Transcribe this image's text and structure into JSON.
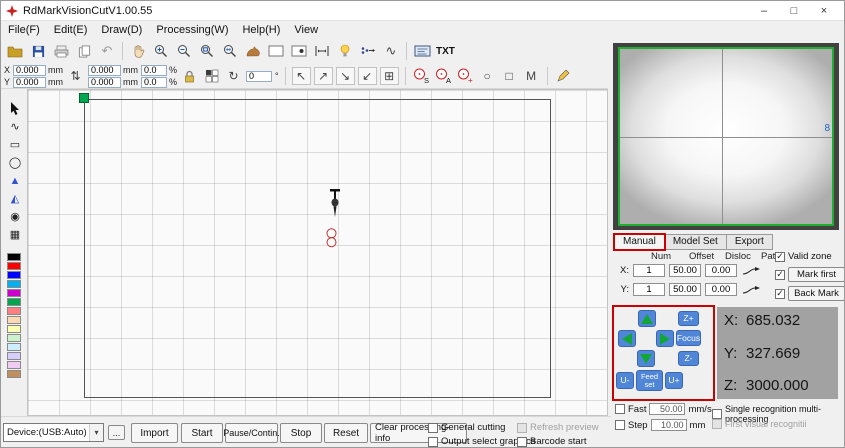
{
  "titlebar": {
    "title": "RdMarkVisionCutV1.00.55",
    "minimize": "–",
    "maximize": "□",
    "close": "×"
  },
  "menu": {
    "items": [
      "File(F)",
      "Edit(E)",
      "Draw(D)",
      "Processing(W)",
      "Help(H)",
      "View"
    ]
  },
  "icons": {
    "undo": "↶",
    "swap": "⇅",
    "grid": "⊞",
    "rotate": "↻",
    "nw": "↖",
    "ne": "↗",
    "se": "↘",
    "sw": "↙",
    "small_circle": "○",
    "small_square": "□",
    "curve": "∿",
    "caret": "▾",
    "tool_curve": "∿",
    "tool_rect": "▭",
    "tool_ellipse": "◯",
    "tool_triangle": "▲",
    "tool_polygon": "◭",
    "tool_spiral": "◉",
    "tool_array": "▦"
  },
  "toolbar": {
    "txt_label": "TXT",
    "angle_value": "0",
    "angle_unit": "°",
    "s": "S",
    "a": "A",
    "plus": "+",
    "m": "M"
  },
  "coord_fields": {
    "x_label": "X",
    "y_label": "Y",
    "x": "0.000",
    "y": "0.000",
    "w": "0.000",
    "h": "0.000",
    "wp": "0.0",
    "hp": "0.0",
    "mm": "mm",
    "pct": "%"
  },
  "palette": {
    "colors": [
      "#000000",
      "#ff0000",
      "#0000ff",
      "#00b0f0",
      "#cc00cc",
      "#00a650",
      "#ff8080",
      "#ffd9b3",
      "#ffffb3",
      "#ccf2cc",
      "#cceeff",
      "#d9ccff",
      "#f2ccf2",
      "#bf8f60"
    ]
  },
  "camera": {
    "scale_marker": "8"
  },
  "tabs": {
    "manual": "Manual",
    "model_set": "Model Set",
    "export": "Export"
  },
  "params": {
    "headers": {
      "num": "Num",
      "offset": "Offset",
      "disloc": "Disloc",
      "path": "Path"
    },
    "x_label": "X:",
    "y_label": "Y:",
    "x": {
      "num": "1",
      "offset": "50.00",
      "disloc": "0.00"
    },
    "y": {
      "num": "1",
      "offset": "50.00",
      "disloc": "0.00"
    },
    "valid_zone": "Valid zone",
    "mark_first": "Mark first",
    "back_mark": "Back Mark"
  },
  "jog": {
    "z_plus": "Z+",
    "focus": "Focus",
    "z_minus": "Z-",
    "u_minus": "U-",
    "feed_set": "Feed set",
    "u_plus": "U+"
  },
  "position": {
    "x_label": "X:",
    "x": "685.032",
    "y_label": "Y:",
    "y": "327.669",
    "z_label": "Z:",
    "z": "3000.000"
  },
  "motion": {
    "fast": "Fast",
    "fast_value": "50.00",
    "fast_unit": "mm/s",
    "step": "Step",
    "step_value": "10.00",
    "step_unit": "mm",
    "single": "Single recognition multi-processing",
    "first": "First visual recognitii"
  },
  "bottom": {
    "device": "Device:(USB:Auto)",
    "more": "...",
    "import": "Import",
    "start": "Start",
    "pause": "Pause/Contin.",
    "stop": "Stop",
    "reset": "Reset",
    "clear": "Clear processing-info",
    "general_cutting": "General cutting",
    "output_select": "Output select graphics",
    "refresh_preview": "Refresh preview",
    "barcode_start": "Barcode start"
  },
  "accent_colors": {
    "jog_blue": "#4f86d8",
    "arrow_green": "#12a638",
    "annotation_red": "#cc0000",
    "camera_green": "#1fae2f",
    "origin_green": "#00a650"
  }
}
